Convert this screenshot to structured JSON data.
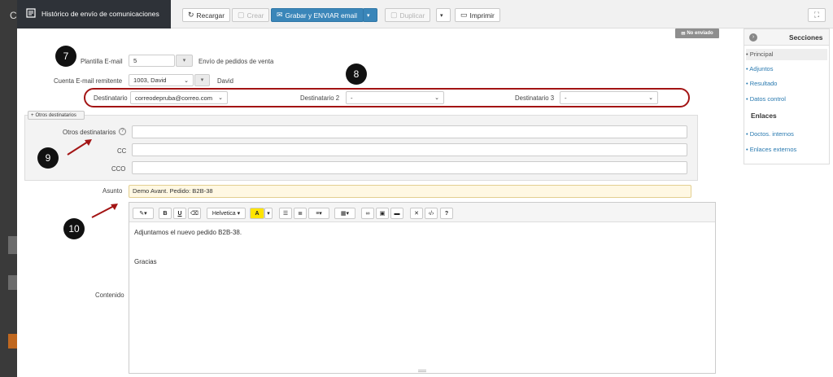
{
  "window": {
    "title": "Histórico de envío de comunicaciones"
  },
  "toolbar": {
    "reload": "Recargar",
    "create": "Crear",
    "save_send": "Grabar y ENVIAR email",
    "duplicate": "Duplicar",
    "print": "Imprimir"
  },
  "status_badge": "No enviado",
  "form": {
    "plantilla_label": "Plantilla E-mail",
    "plantilla_value": "5",
    "plantilla_desc": "Envío de pedidos de venta",
    "cuenta_label": "Cuenta E-mail remitente",
    "cuenta_value": "1003, David",
    "cuenta_desc": "David",
    "destinatario_label": "Destinatario",
    "destinatario_value": "correodepruba@correo.com",
    "destinatario2_label": "Destinatario 2",
    "destinatario2_value": "-",
    "destinatario3_label": "Destinatario 3",
    "destinatario3_value": "-",
    "otros_button": "Otros destinatarios",
    "otros_label": "Otros destinatarios",
    "cc_label": "CC",
    "cco_label": "CCO",
    "asunto_label": "Asunto",
    "asunto_value": "Demo Avant. Pedido: B2B-38",
    "contenido_label": "Contenido"
  },
  "editor": {
    "font": "Helvetica",
    "line1": "Adjuntamos el nuevo pedido B2B-38.",
    "line2": "Gracias"
  },
  "callouts": [
    "7",
    "8",
    "9",
    "10"
  ],
  "sidebar": {
    "secciones_title": "Secciones",
    "items": [
      "Principal",
      "Adjuntos",
      "Resultado",
      "Datos control"
    ],
    "enlaces_title": "Enlaces",
    "links": [
      "Doctos. internos",
      "Enlaces externos"
    ]
  },
  "left_strip_letter": "C",
  "colors": {
    "primary": "#3a86b9",
    "highlight": "#a31414",
    "title_bg": "#2e3238"
  }
}
